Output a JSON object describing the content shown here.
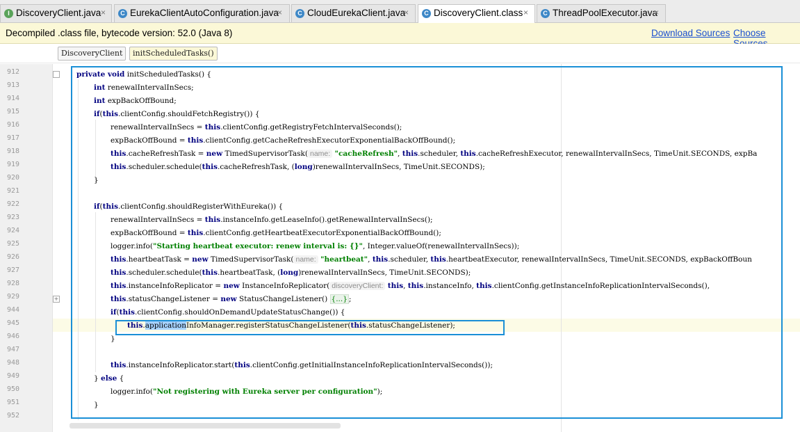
{
  "tabs": [
    {
      "label": "DiscoveryClient.java",
      "icon": "interface-icon",
      "glyph": "I",
      "active": false
    },
    {
      "label": "EurekaClientAutoConfiguration.java",
      "icon": "class-icon",
      "glyph": "C",
      "active": false
    },
    {
      "label": "CloudEurekaClient.java",
      "icon": "class-icon",
      "glyph": "C",
      "active": false
    },
    {
      "label": "DiscoveryClient.class",
      "icon": "class-icon",
      "glyph": "C",
      "active": true
    },
    {
      "label": "ThreadPoolExecutor.java",
      "icon": "class-icon",
      "glyph": "C",
      "active": false
    }
  ],
  "close_glyph": "×",
  "banner": {
    "text": "Decompiled .class file, bytecode version: 52.0 (Java 8)",
    "download_sources": "Download Sources",
    "choose_sources": "Choose Sources..."
  },
  "breadcrumb": [
    "DiscoveryClient",
    "initScheduledTasks()"
  ],
  "line_numbers": [
    "912",
    "913",
    "914",
    "915",
    "916",
    "917",
    "918",
    "919",
    "920",
    "921",
    "922",
    "923",
    "924",
    "925",
    "926",
    "927",
    "928",
    "929",
    "944",
    "945",
    "946",
    "947",
    "948",
    "949",
    "950",
    "951",
    "952"
  ],
  "code": {
    "l912_a": "private void",
    "l912_b": " initScheduledTasks() {",
    "l913_a": "int",
    "l913_b": " renewalIntervalInSecs;",
    "l914_a": "int",
    "l914_b": " expBackOffBound;",
    "l915_a": "if",
    "l915_b": "(",
    "l915_c": "this",
    "l915_d": ".clientConfig.shouldFetchRegistry()) {",
    "l916_a": "renewalIntervalInSecs = ",
    "l916_b": "this",
    "l916_c": ".clientConfig.getRegistryFetchIntervalSeconds();",
    "l917_a": "expBackOffBound = ",
    "l917_b": "this",
    "l917_c": ".clientConfig.getCacheRefreshExecutorExponentialBackOffBound();",
    "l918_a": "this",
    "l918_b": ".cacheRefreshTask = ",
    "l918_c": "new",
    "l918_d": " TimedSupervisorTask(",
    "l918_hint": "name:",
    "l918_str": "\"cacheRefresh\"",
    "l918_e": ", ",
    "l918_f": "this",
    "l918_g": ".scheduler, ",
    "l918_h": "this",
    "l918_i": ".cacheRefreshExecutor, renewalIntervalInSecs, TimeUnit.SECONDS, expBa",
    "l919_a": "this",
    "l919_b": ".scheduler.schedule(",
    "l919_c": "this",
    "l919_d": ".cacheRefreshTask, (",
    "l919_e": "long",
    "l919_f": ")renewalIntervalInSecs, TimeUnit.SECONDS);",
    "l920": "}",
    "l922_a": "if",
    "l922_b": "(",
    "l922_c": "this",
    "l922_d": ".clientConfig.shouldRegisterWithEureka()) {",
    "l923_a": "renewalIntervalInSecs = ",
    "l923_b": "this",
    "l923_c": ".instanceInfo.getLeaseInfo().getRenewalIntervalInSecs();",
    "l924_a": "expBackOffBound = ",
    "l924_b": "this",
    "l924_c": ".clientConfig.getHeartbeatExecutorExponentialBackOffBound();",
    "l925_a": "logger.info(",
    "l925_str": "\"Starting heartbeat executor: renew interval is: {}\"",
    "l925_b": ", Integer.valueOf(renewalIntervalInSecs));",
    "l926_a": "this",
    "l926_b": ".heartbeatTask = ",
    "l926_c": "new",
    "l926_d": " TimedSupervisorTask(",
    "l926_hint": "name:",
    "l926_str": "\"heartbeat\"",
    "l926_e": ", ",
    "l926_f": "this",
    "l926_g": ".scheduler, ",
    "l926_h": "this",
    "l926_i": ".heartbeatExecutor, renewalIntervalInSecs, TimeUnit.SECONDS, expBackOffBoun",
    "l927_a": "this",
    "l927_b": ".scheduler.schedule(",
    "l927_c": "this",
    "l927_d": ".heartbeatTask, (",
    "l927_e": "long",
    "l927_f": ")renewalIntervalInSecs, TimeUnit.SECONDS);",
    "l928_a": "this",
    "l928_b": ".instanceInfoReplicator = ",
    "l928_c": "new",
    "l928_d": " InstanceInfoReplicator(",
    "l928_hint": "discoveryClient:",
    "l928_e": "this",
    "l928_f": ", ",
    "l928_g": "this",
    "l928_h": ".instanceInfo, ",
    "l928_i": "this",
    "l928_j": ".clientConfig.getInstanceInfoReplicationIntervalSeconds(), ",
    "l929_a": "this",
    "l929_b": ".statusChangeListener = ",
    "l929_c": "new",
    "l929_d": " StatusChangeListener() ",
    "l929_fold": "{...}",
    "l929_e": ";",
    "l944_a": "if",
    "l944_b": "(",
    "l944_c": "this",
    "l944_d": ".clientConfig.shouldOnDemandUpdateStatusChange()) {",
    "l945_a": "this",
    "l945_b": ".",
    "l945_sel": "application",
    "l945_c": "InfoManager.registerStatusChangeListener(",
    "l945_d": "this",
    "l945_e": ".statusChangeListener);",
    "l946": "}",
    "l948_a": "this",
    "l948_b": ".instanceInfoReplicator.start(",
    "l948_c": "this",
    "l948_d": ".clientConfig.getInitialInstanceInfoReplicationIntervalSeconds());",
    "l949_a": "} ",
    "l949_b": "else",
    "l949_c": " {",
    "l950_a": "logger.info(",
    "l950_str": "\"Not registering with Eureka server per configuration\"",
    "l950_b": ");",
    "l951": "}"
  }
}
